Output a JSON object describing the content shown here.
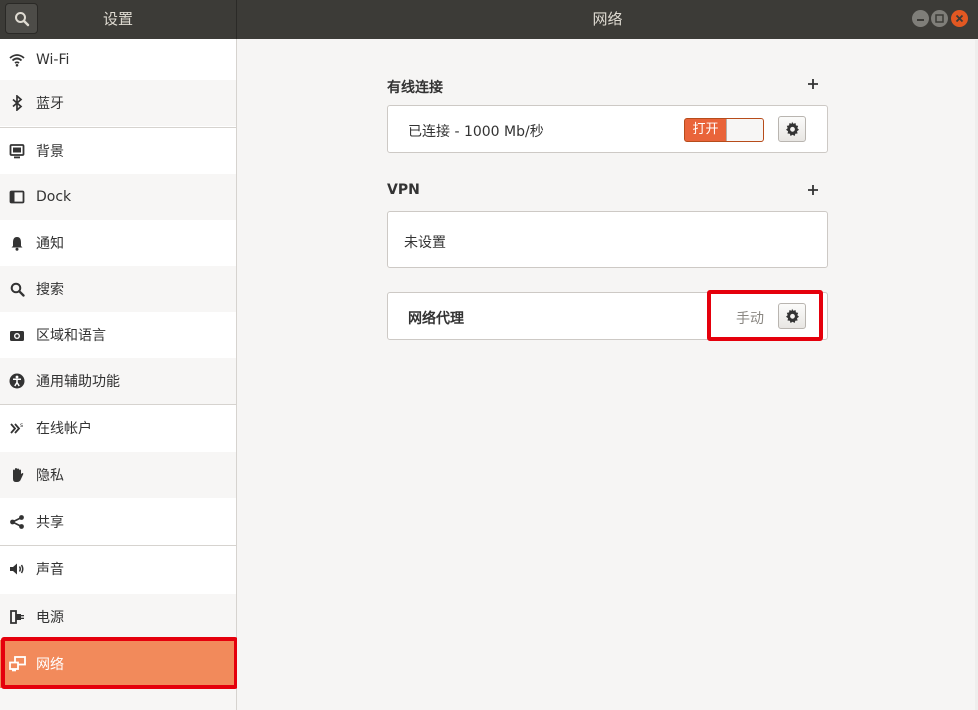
{
  "header": {
    "settings_title": "设置",
    "page_title": "网络"
  },
  "sidebar": {
    "items": [
      {
        "label": "Wi-Fi",
        "icon": "wifi-icon"
      },
      {
        "label": "蓝牙",
        "icon": "bluetooth-icon"
      },
      {
        "label": "背景",
        "icon": "background-icon"
      },
      {
        "label": "Dock",
        "icon": "dock-icon"
      },
      {
        "label": "通知",
        "icon": "bell-icon"
      },
      {
        "label": "搜索",
        "icon": "search-icon"
      },
      {
        "label": "区域和语言",
        "icon": "camera-icon"
      },
      {
        "label": "通用辅助功能",
        "icon": "accessibility-icon"
      },
      {
        "label": "在线帐户",
        "icon": "online-accounts-icon"
      },
      {
        "label": "隐私",
        "icon": "hand-icon"
      },
      {
        "label": "共享",
        "icon": "share-icon"
      },
      {
        "label": "声音",
        "icon": "speaker-icon"
      },
      {
        "label": "电源",
        "icon": "power-icon"
      },
      {
        "label": "网络",
        "icon": "network-icon"
      }
    ],
    "active_index": 13,
    "active_color": "#f28a5b"
  },
  "main": {
    "wired": {
      "title": "有线连接",
      "status": "已连接 - 1000 Mb/秒",
      "toggle_label": "打开"
    },
    "vpn": {
      "title": "VPN",
      "status": "未设置"
    },
    "proxy": {
      "title": "网络代理",
      "value": "手动"
    }
  },
  "colors": {
    "accent": "#e9643a",
    "highlight": "#e5000c",
    "headerbar": "#3c3b37"
  }
}
